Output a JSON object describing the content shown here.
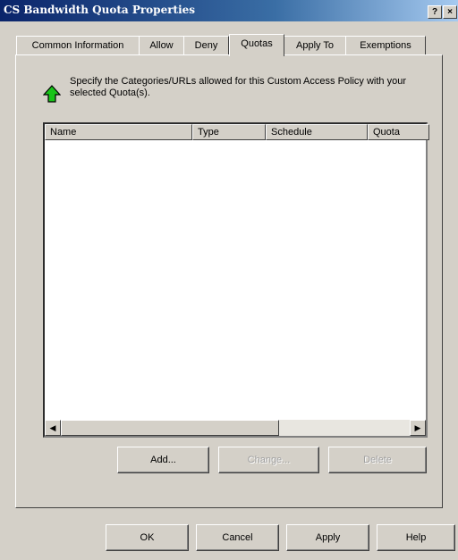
{
  "window": {
    "title": "CS Bandwidth Quota Properties",
    "help_btn": "?",
    "close_btn": "×"
  },
  "tabs": [
    {
      "label": "Common Information"
    },
    {
      "label": "Allow"
    },
    {
      "label": "Deny"
    },
    {
      "label": "Quotas"
    },
    {
      "label": "Apply To"
    },
    {
      "label": "Exemptions"
    }
  ],
  "active_tab": "Quotas",
  "quotas": {
    "description": "Specify the Categories/URLs allowed for this Custom Access Policy with your selected Quota(s).",
    "columns": [
      "Name",
      "Type",
      "Schedule",
      "Quota"
    ],
    "rows": [],
    "buttons": {
      "add": "Add...",
      "change": "Change...",
      "delete": "Delete"
    }
  },
  "dialog_buttons": {
    "ok": "OK",
    "cancel": "Cancel",
    "apply": "Apply",
    "help": "Help"
  },
  "icons": {
    "info": "green-up-arrow-icon",
    "scroll_left": "scroll-left-arrow-icon",
    "scroll_right": "scroll-right-arrow-icon"
  }
}
